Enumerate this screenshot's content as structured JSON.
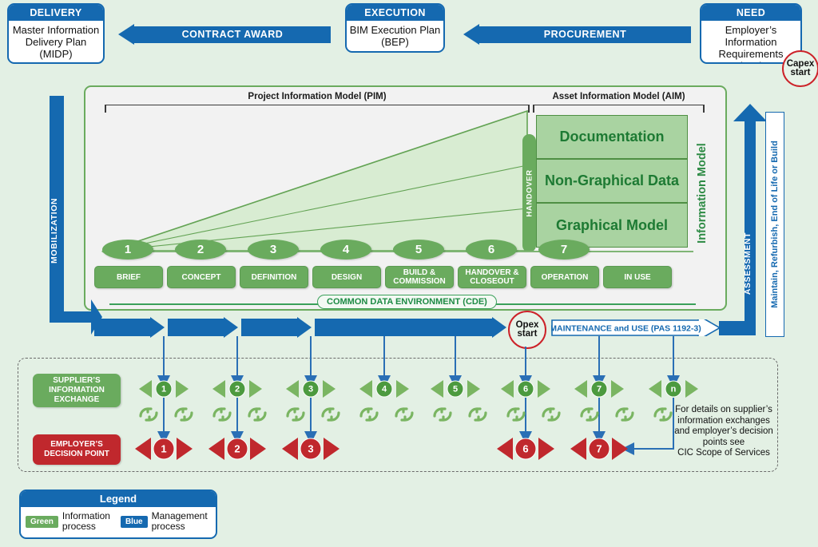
{
  "theme": {
    "background": "#e3f0e4",
    "blue": "#1569b0",
    "green": "#6aab5e",
    "green_dark": "#1d7a33",
    "red": "#c0282d",
    "panel": "#f2f2f2"
  },
  "gateways": [
    {
      "title": "DELIVERY",
      "body": "Master Information\nDelivery Plan\n(MIDP)"
    },
    {
      "title": "EXECUTION",
      "body": "BIM Execution Plan\n(BEP)"
    },
    {
      "title": "NEED",
      "body": "Employer's Information\nRequirements\n(EIR)"
    }
  ],
  "top_arrows": [
    {
      "label": "CONTRACT AWARD"
    },
    {
      "label": "PROCUREMENT"
    }
  ],
  "markers": {
    "capex": "Capex\nstart",
    "capex_line1": "Capex",
    "capex_line2": "start",
    "opex_line1": "Opex",
    "opex_line2": "start"
  },
  "panel": {
    "pim_label": "Project Information Model (PIM)",
    "aim_label": "Asset Information Model (AIM)",
    "handover_label": "HANDOVER",
    "information_model_label": "Information Model",
    "aim_layers": [
      "Documentation",
      "Non-Graphical Data",
      "Graphical Model"
    ],
    "cde_label": "COMMON DATA ENVIRONMENT (CDE)"
  },
  "stages": [
    {
      "number": "1",
      "label": "BRIEF"
    },
    {
      "number": "2",
      "label": "CONCEPT"
    },
    {
      "number": "3",
      "label": "DEFINITION"
    },
    {
      "number": "4",
      "label": "DESIGN"
    },
    {
      "number": "5",
      "label": "BUILD &\nCOMMISSION"
    },
    {
      "number": "6",
      "label": "HANDOVER &\nCLOSEOUT"
    },
    {
      "number": "7",
      "label": "OPERATION"
    },
    {
      "number": "",
      "label": "IN USE"
    }
  ],
  "side_labels": {
    "mobilization": "MOBILIZATION",
    "assessment": "ASSESSMENT",
    "maintenance_vertical": "Maintain, Refurbish, End of Life or Build"
  },
  "maintenance_arrow": {
    "label": "MAINTENANCE and USE (PAS 1192-3)"
  },
  "bottom": {
    "supplier_badge": "SUPPLIER'S\nINFORMATION\nEXCHANGE",
    "employer_badge": "EMPLOYER'S\nDECISION POINT",
    "supplier_exchanges": [
      "1",
      "2",
      "3",
      "4",
      "5",
      "6",
      "7",
      "n"
    ],
    "employer_points": [
      "1",
      "2",
      "3",
      "6",
      "7"
    ],
    "note": "For details on supplier's information exchanges and employer's decision points see CIC Scope of Services"
  },
  "legend": {
    "title": "Legend",
    "items": [
      {
        "swatch": "Green",
        "color": "#6aab5e",
        "text": "Information\nprocess"
      },
      {
        "swatch": "Blue",
        "color": "#1569b0",
        "text": "Management\nprocess"
      }
    ]
  }
}
